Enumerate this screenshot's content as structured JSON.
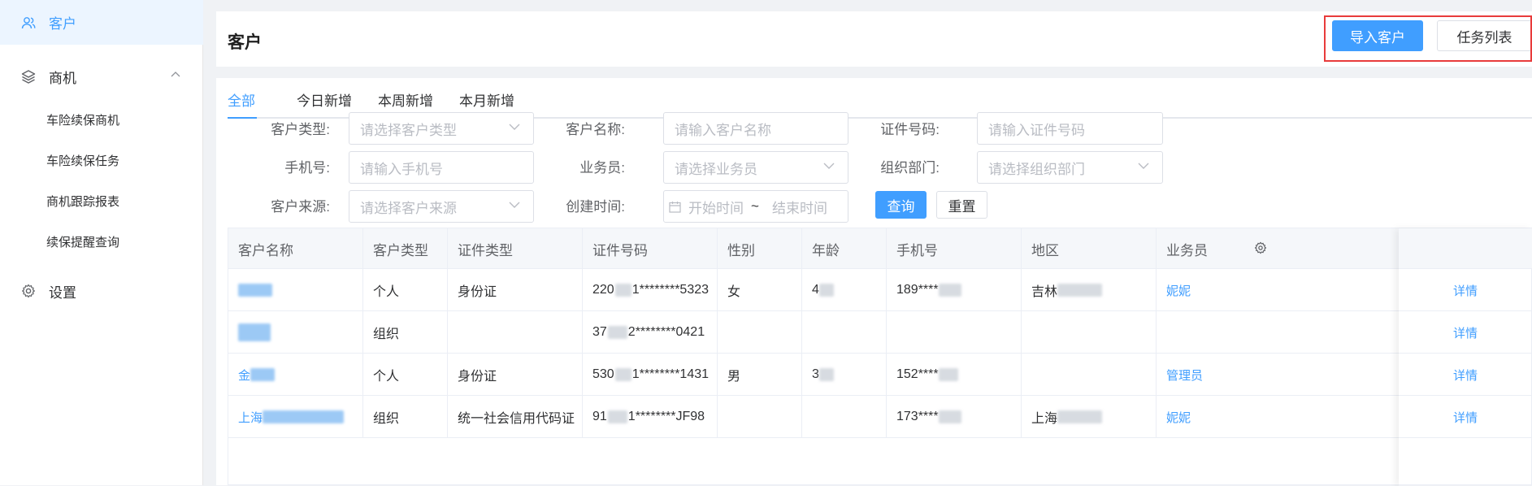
{
  "sidebar": {
    "items": [
      {
        "label": "客户",
        "icon": "users-icon",
        "active": true
      },
      {
        "label": "商机",
        "icon": "layers-icon",
        "expanded": true
      }
    ],
    "sub_items": [
      {
        "label": "车险续保商机"
      },
      {
        "label": "车险续保任务"
      },
      {
        "label": "商机跟踪报表"
      },
      {
        "label": "续保提醒查询"
      }
    ],
    "settings": {
      "label": "设置",
      "icon": "gear-icon"
    }
  },
  "header": {
    "title": "客户",
    "import_button": "导入客户",
    "tasks_button": "任务列表"
  },
  "tabs": [
    "全部",
    "今日新增",
    "本周新增",
    "本月新增"
  ],
  "filters": {
    "customer_type": {
      "label": "客户类型:",
      "placeholder": "请选择客户类型"
    },
    "customer_name": {
      "label": "客户名称:",
      "placeholder": "请输入客户名称"
    },
    "id_number": {
      "label": "证件号码:",
      "placeholder": "请输入证件号码"
    },
    "phone": {
      "label": "手机号:",
      "placeholder": "请输入手机号"
    },
    "salesperson": {
      "label": "业务员:",
      "placeholder": "请选择业务员"
    },
    "department": {
      "label": "组织部门:",
      "placeholder": "请选择组织部门"
    },
    "source": {
      "label": "客户来源:",
      "placeholder": "请选择客户来源"
    },
    "created": {
      "label": "创建时间:",
      "start": "开始时间",
      "sep": "~",
      "end": "结束时间"
    },
    "query_button": "查询",
    "reset_button": "重置"
  },
  "table": {
    "columns": [
      "客户名称",
      "客户类型",
      "证件类型",
      "证件号码",
      "性别",
      "年龄",
      "手机号",
      "地区",
      "业务员"
    ],
    "rows": [
      {
        "name": "",
        "type": "个人",
        "id_type": "身份证",
        "id_prefix": "220",
        "id_suffix": "1********5323",
        "gender": "女",
        "age": "4",
        "phone": "189****",
        "region": "吉林",
        "sales": "妮妮",
        "action": "详情"
      },
      {
        "name": "",
        "type": "组织",
        "id_type": "",
        "id_prefix": "37",
        "id_suffix": "2********0421",
        "gender": "",
        "age": "",
        "phone": "",
        "region": "",
        "sales": "",
        "action": "详情"
      },
      {
        "name": "金",
        "type": "个人",
        "id_type": "身份证",
        "id_prefix": "530",
        "id_suffix": "1********1431",
        "gender": "男",
        "age": "3",
        "phone": "152****",
        "region": "",
        "sales": "管理员",
        "action": "详情"
      },
      {
        "name": "上海",
        "type": "组织",
        "id_type": "统一社会信用代码证",
        "id_prefix": "91",
        "id_suffix": "1********JF98",
        "gender": "",
        "age": "",
        "phone": "173****",
        "region": "上海",
        "sales": "妮妮",
        "action": "详情"
      }
    ]
  }
}
